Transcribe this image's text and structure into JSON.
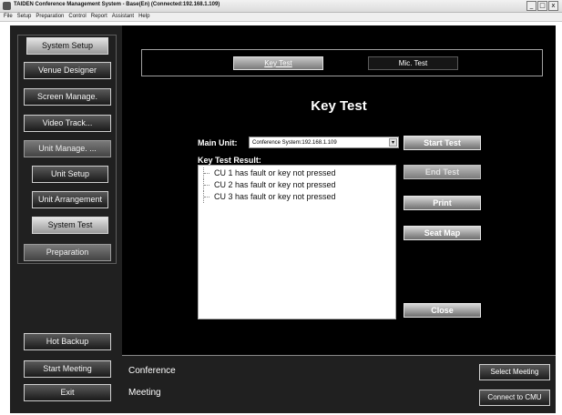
{
  "window": {
    "title": "TAIDEN Conference Management System - Base(En) (Connected:192.168.1.109)",
    "controls": [
      "_",
      "□",
      "x"
    ]
  },
  "menu": [
    "File",
    "Setup",
    "Preparation",
    "Control",
    "Report",
    "Assistant",
    "Help"
  ],
  "sidebar": {
    "system_setup": "System Setup",
    "venue_designer": "Venue Designer",
    "screen_manage": "Screen Manage.",
    "video_track": "Video Track...",
    "unit_manage": "Unit Manage. ...",
    "unit_setup": "Unit Setup",
    "unit_arrangement": "Unit Arrangement",
    "system_test": "System Test",
    "preparation": "Preparation",
    "hot_backup": "Hot Backup",
    "start_meeting": "Start Meeting",
    "exit": "Exit"
  },
  "tabs": {
    "key_test": "Key Test",
    "mic_test": "Mic. Test"
  },
  "main": {
    "title": "Key Test",
    "main_unit_label": "Main Unit:",
    "main_unit_value": "Conference System:192.168.1.109",
    "result_label": "Key Test Result:",
    "results": [
      "CU 1 has fault or key not pressed",
      "CU 2 has fault or key not pressed",
      "CU 3 has fault or key not pressed"
    ]
  },
  "actions": {
    "start_test": "Start Test",
    "end_test": "End Test",
    "print": "Print",
    "seat_map": "Seat Map",
    "close": "Close"
  },
  "bottom": {
    "conference_label": "Conference",
    "meeting_label": "Meeting",
    "select_meeting": "Select Meeting",
    "connect_cmu": "Connect to CMU"
  }
}
